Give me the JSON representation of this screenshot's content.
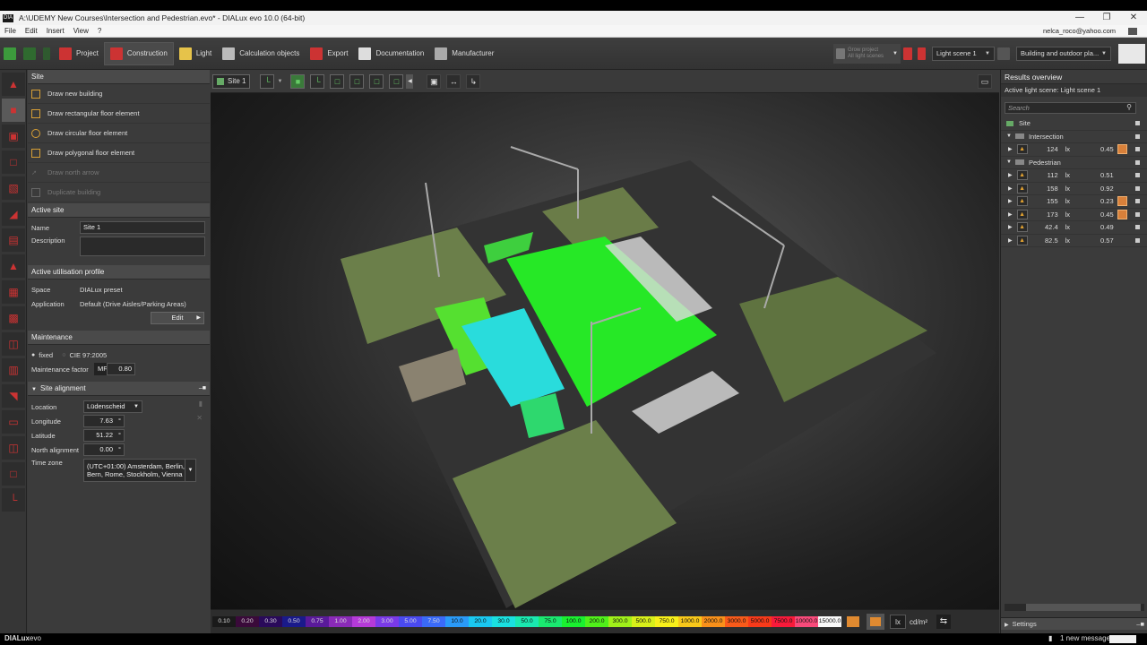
{
  "window": {
    "title": "A:\\UDEMY New Courses\\Intersection and Pedestrian.evo* - DIALux evo 10.0  (64-bit)",
    "app_icon": "DIA"
  },
  "menu": [
    "File",
    "Edit",
    "Insert",
    "View",
    "?"
  ],
  "user": "nelca_roco@yahoo.com",
  "toolbar": {
    "tabs": [
      "Project",
      "Construction",
      "Light",
      "Calculation objects",
      "Export",
      "Documentation",
      "Manufacturer"
    ],
    "grow_project": "Grow project",
    "all_light_scenes": "All light scenes",
    "light_scene": "Light scene 1",
    "view_mode": "Building and outdoor pla..."
  },
  "site_panel": {
    "title": "Site",
    "actions": [
      {
        "label": "Draw new building",
        "enabled": true
      },
      {
        "label": "Draw rectangular floor element",
        "enabled": true
      },
      {
        "label": "Draw circular floor element",
        "enabled": true
      },
      {
        "label": "Draw polygonal floor element",
        "enabled": true
      },
      {
        "label": "Draw north arrow",
        "enabled": false
      },
      {
        "label": "Duplicate building",
        "enabled": false
      }
    ]
  },
  "active_site": {
    "title": "Active site",
    "name_label": "Name",
    "name": "Site 1",
    "description_label": "Description",
    "description": ""
  },
  "profile": {
    "title": "Active utilisation profile",
    "space_label": "Space",
    "space": "DIALux preset",
    "application_label": "Application",
    "application": "Default (Drive Aisles/Parking Areas)",
    "edit": "Edit"
  },
  "maintenance": {
    "title": "Maintenance",
    "fixed": "fixed",
    "cie": "CIE 97:2005",
    "factor_label": "Maintenance factor",
    "mf_label": "MF",
    "mf": "0.80"
  },
  "alignment": {
    "title": "Site alignment",
    "location_label": "Location",
    "location": "Lüdenscheid",
    "longitude_label": "Longitude",
    "longitude": "7.63",
    "latitude_label": "Latitude",
    "latitude": "51.22",
    "north_label": "North alignment",
    "north": "0.00",
    "timezone_label": "Time zone",
    "timezone_line1": "(UTC+01:00) Amsterdam, Berlin,",
    "timezone_line2": "Bern, Rome, Stockholm, Vienna",
    "degree": "°"
  },
  "viewport": {
    "tab": "Site 1"
  },
  "legend": {
    "values": [
      "0.10",
      "0.20",
      "0.30",
      "0.50",
      "0.75",
      "1.00",
      "2.00",
      "3.00",
      "5.00",
      "7.50",
      "10.0",
      "20.0",
      "30.0",
      "50.0",
      "75.0",
      "100.0",
      "200.0",
      "300.0",
      "500.0",
      "750.0",
      "1000.0",
      "2000.0",
      "3000.0",
      "5000.0",
      "7500.0",
      "10000.0",
      "15000.0"
    ],
    "colors": [
      "#1a1a1a",
      "#3a0a3a",
      "#2a0a5a",
      "#1a1a8a",
      "#5a1a9a",
      "#8a2ab8",
      "#b53ad8",
      "#7a3ae8",
      "#4a4af0",
      "#3a6af8",
      "#2a9af8",
      "#1ac8f0",
      "#1ae0e0",
      "#1ae8b0",
      "#1ae870",
      "#1af030",
      "#50f01a",
      "#a0f01a",
      "#d8f01a",
      "#f8f01a",
      "#f8c81a",
      "#f8901a",
      "#f85a1a",
      "#f83a1a",
      "#f81a3a",
      "#f84a7a",
      "#f8f8f8"
    ],
    "unit_lx": "lx",
    "unit_cd": "cd/m²"
  },
  "results": {
    "title": "Results overview",
    "active_scene": "Active light scene: Light scene 1",
    "search_placeholder": "Search",
    "site": "Site",
    "groups": [
      {
        "name": "Intersection",
        "rows": [
          {
            "value": "124",
            "unit": "lx",
            "ratio": "0.45",
            "warn": true
          }
        ]
      },
      {
        "name": "Pedestrian",
        "rows": [
          {
            "value": "112",
            "unit": "lx",
            "ratio": "0.51",
            "warn": false
          },
          {
            "value": "158",
            "unit": "lx",
            "ratio": "0.92",
            "warn": false
          },
          {
            "value": "155",
            "unit": "lx",
            "ratio": "0.23",
            "warn": true
          },
          {
            "value": "173",
            "unit": "lx",
            "ratio": "0.45",
            "warn": true
          },
          {
            "value": "42.4",
            "unit": "lx",
            "ratio": "0.49",
            "warn": false
          },
          {
            "value": "82.5",
            "unit": "lx",
            "ratio": "0.57",
            "warn": false
          }
        ]
      }
    ],
    "settings": "Settings",
    "new_message": "1 new message"
  },
  "status": {
    "brand_a": "DIALux",
    "brand_b": "evo"
  }
}
